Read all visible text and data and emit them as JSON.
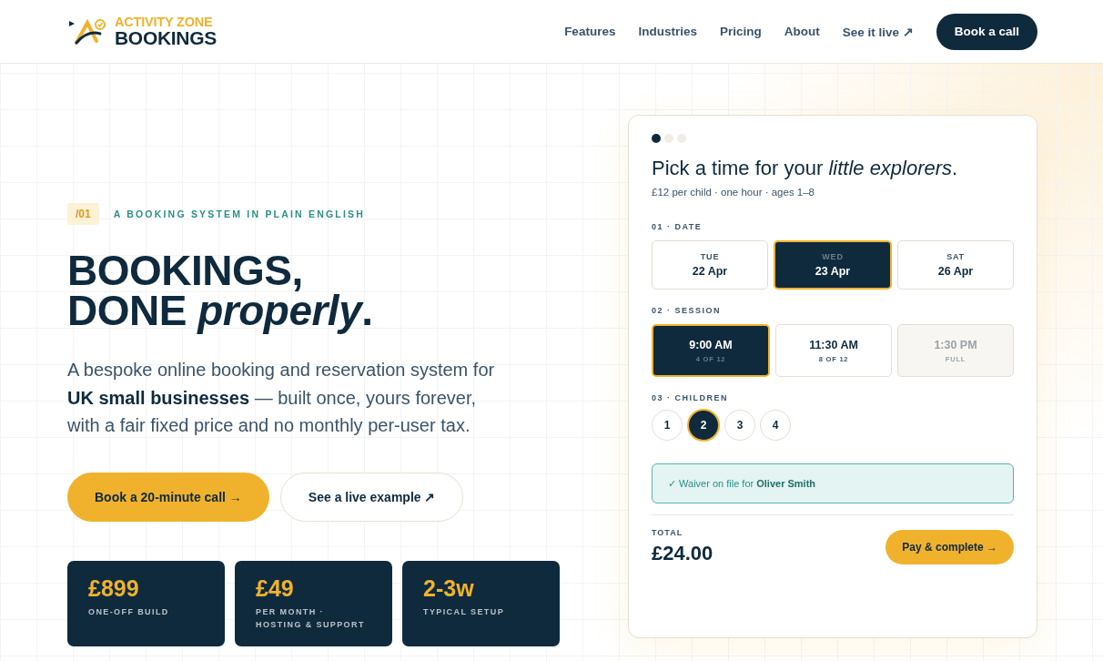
{
  "header": {
    "logo": {
      "line1": "ACTIVITY ZONE",
      "line2": "BOOKINGS"
    },
    "nav": [
      {
        "label": "Features"
      },
      {
        "label": "Industries"
      },
      {
        "label": "Pricing"
      },
      {
        "label": "About"
      },
      {
        "label": "See it live ↗"
      }
    ],
    "cta": "Book a call"
  },
  "hero": {
    "tag": "/01",
    "eyebrow": "A BOOKING SYSTEM IN PLAIN ENGLISH",
    "headline": [
      "BOOKINGS,",
      "DONE *properly*."
    ],
    "description": "A bespoke online booking and reservation system for **UK small businesses** — built once, yours forever, with a fair fixed price and no monthly per-user tax.",
    "buttons": [
      {
        "kind": "primary",
        "label": "Book a 20-minute call →"
      },
      {
        "kind": "secondary",
        "label": "See a live example ↗"
      }
    ],
    "stats": [
      {
        "value": "£899",
        "label": "ONE-OFF BUILD"
      },
      {
        "value": "£49",
        "label": "PER MONTH · HOSTING & SUPPORT"
      },
      {
        "value": "2-3w",
        "label": "TYPICAL SETUP"
      }
    ]
  },
  "booking": {
    "steps": [
      {
        "selected": true
      },
      {
        "selected": false
      },
      {
        "selected": false
      }
    ],
    "title": "Pick a time for your *little explorers*.",
    "subtitle": "£12 per child · one hour · ages 1–8",
    "date_label": "01 · DATE",
    "dates": [
      {
        "day": "TUE",
        "date": "22 Apr",
        "selected": false
      },
      {
        "day": "WED",
        "date": "23 Apr",
        "selected": true
      },
      {
        "day": "SAT",
        "date": "26 Apr",
        "selected": false
      }
    ],
    "session_label": "02 · SESSION",
    "sessions": [
      {
        "time": "9:00 AM",
        "availability": "4 OF 12",
        "selected": true,
        "disabled": false
      },
      {
        "time": "11:30 AM",
        "availability": "8 OF 12",
        "selected": false,
        "disabled": false
      },
      {
        "time": "1:30 PM",
        "availability": "FULL",
        "selected": false,
        "disabled": true
      }
    ],
    "children_label": "03 · CHILDREN",
    "children": [
      {
        "label": "1",
        "selected": false
      },
      {
        "label": "2",
        "selected": true
      },
      {
        "label": "3",
        "selected": false
      },
      {
        "label": "4",
        "selected": false
      }
    ],
    "waiver": "✓ Waiver on file for **Oliver Smith**",
    "total_label": "TOTAL",
    "total": "£24.00",
    "pay": "Pay & complete →"
  }
}
